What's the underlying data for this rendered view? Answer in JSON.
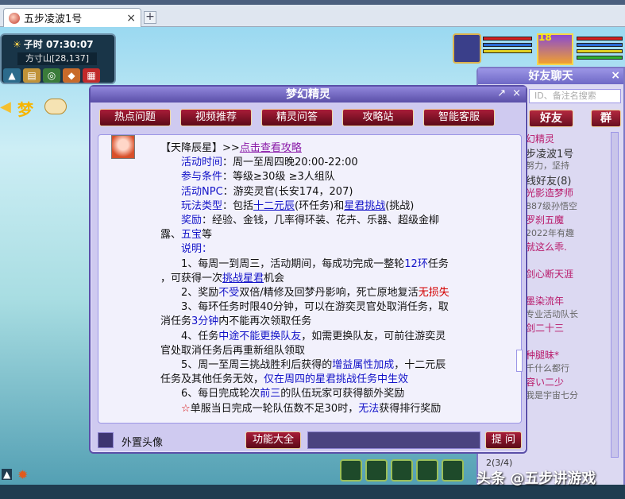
{
  "browser": {
    "tab_title": "五步凌波1号",
    "tab_close": "×",
    "new_tab": "+"
  },
  "hud": {
    "time": "子时 07:30:07",
    "location": "方寸山[28,137]"
  },
  "player": {
    "level": "18"
  },
  "friends": {
    "title": "好友聊天",
    "close": "×",
    "search_placeholder": "ID、备注名搜索",
    "tab_friends": "好友",
    "tab_group": "群",
    "items": [
      {
        "text": "幻精灵",
        "type": "fname"
      },
      {
        "text": "步凌波1号",
        "type": "fgroup"
      },
      {
        "text": "努力，坚持",
        "type": "fsub"
      },
      {
        "text": "线好友(8)",
        "type": "fgroup"
      },
      {
        "text": "光影造梦师",
        "type": "fname"
      },
      {
        "text": "887级孙悟空",
        "type": "fsub"
      },
      {
        "text": "罗刹五魔",
        "type": "fname"
      },
      {
        "text": "2022年有趣",
        "type": "fsub"
      },
      {
        "text": "就这么乖.",
        "type": "fname"
      },
      {
        "text": "",
        "type": "fsub"
      },
      {
        "text": "剑心断天涯",
        "type": "fname"
      },
      {
        "text": "",
        "type": "fsub"
      },
      {
        "text": "墨染流年",
        "type": "fname"
      },
      {
        "text": "专业活动队长",
        "type": "fsub"
      },
      {
        "text": "剑二十三",
        "type": "fname"
      },
      {
        "text": "",
        "type": "fsub"
      },
      {
        "text": "种腿昧*",
        "type": "fname"
      },
      {
        "text": "千什么都行",
        "type": "fsub"
      },
      {
        "text": "容い二少",
        "type": "fname"
      },
      {
        "text": "我是宇宙七分",
        "type": "fsub"
      }
    ],
    "page": "2(3/4)"
  },
  "dialog": {
    "title": "梦幻精灵",
    "pin": "↗",
    "close": "×",
    "buttons": [
      "热点问题",
      "视频推荐",
      "精灵问答",
      "攻略站",
      "智能客服"
    ],
    "header_tag": "【天降辰星】",
    "header_arrows": ">>",
    "header_link": "点击查看攻略",
    "lines": {
      "time_label": "活动时间",
      "time_value": "：周一至周四晚20:00-22:00",
      "cond_label": "参与条件",
      "cond_value": "：等级≥30级 ≥3人组队",
      "npc_label": "活动NPC",
      "npc_value": "：游奕灵官(长安174，207)",
      "type_label": "玩法类型",
      "type_pre": "：包括",
      "type_link1": "十二元辰",
      "type_mid": "(环任务)和",
      "type_link2": "星君挑战",
      "type_post": "(挑战)",
      "reward_label": "奖励",
      "reward_value": "：经验、金钱，几率得环装、花卉、乐器、超级金柳",
      "reward_cont1": "露、",
      "reward_cont2": "五宝",
      "reward_cont3": "等",
      "note_label": "说明：",
      "n1a": "1、每周一到周三，活动期间，每成功完成一整轮",
      "n1b": "12环",
      "n1c": "任务",
      "n1d": "，可获得一次",
      "n1e": "挑战星君",
      "n1f": "机会",
      "n2a": "2、奖励",
      "n2b": "不受",
      "n2c": "双倍/精修及回梦丹影响，死亡原地复活",
      "n2d": "无损失",
      "n3a": "3、每环任务时限40分钟，可以在游奕灵官处取消任务，取",
      "n3b": "消任务",
      "n3c": "3分钟",
      "n3d": "内不能再次领取任务",
      "n4a": "4、任务",
      "n4b": "中途不能更换队友",
      "n4c": "，如需更换队友，可前往游奕灵",
      "n4d": "官处取消任务后再重新组队领取",
      "n5a": "5、周一至周三挑战胜利后获得的",
      "n5b": "增益属性加成",
      "n5c": "，十二元辰",
      "n5d": "任务及其他任务无效，",
      "n5e": "仅在周四的星君挑战任务中生效",
      "n6a": "6、每日完成轮次",
      "n6b": "前三",
      "n6c": "的队伍玩家可获得额外奖励",
      "n7a": "☆",
      "n7b": "单服当日完成一轮队伍数不足30时，",
      "n7c": "无法",
      "n7d": "获得排行奖励"
    },
    "checkbox_label": "外置头像",
    "feature_button": "功能大全",
    "ask_button": "提 问"
  },
  "watermark": "头条 @五步讲游戏"
}
